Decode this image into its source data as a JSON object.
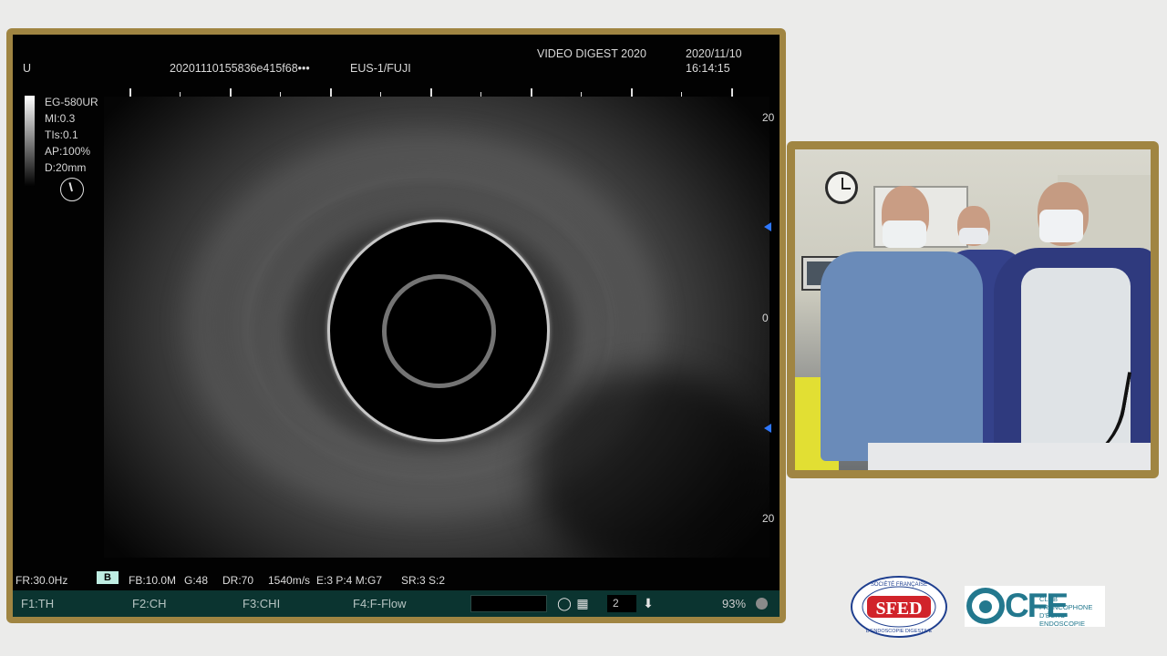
{
  "ultrasound": {
    "header": {
      "probe_orientation": "U",
      "study_id": "20201110155836e415f68•••",
      "scope": "EUS-1/FUJI",
      "event": "VIDEO DIGEST 2020",
      "date": "2020/11/10",
      "time": "16:14:15"
    },
    "params": [
      "EG-580UR",
      "MI:0.3",
      "TIs:0.1",
      "AP:100%",
      "D:20mm"
    ],
    "focus_mark": "F",
    "depth_scale": [
      "20",
      "0",
      "20"
    ],
    "status": {
      "frame_rate": "FR:30.0Hz",
      "mode": "B",
      "fb": "FB:10.0M",
      "gain": "G:48",
      "dynamic_range": "DR:70",
      "speed": "1540m/s",
      "enhance": "E:3 P:4 M:G7",
      "sr": "SR:3 S:2"
    },
    "function_keys": [
      {
        "key": "F1:",
        "label": "TH"
      },
      {
        "key": "F2:",
        "label": "CH"
      },
      {
        "key": "F3:",
        "label": "CHI"
      },
      {
        "key": "F4:",
        "label": "F-Flow"
      }
    ],
    "clip_count": "2",
    "storage": "93%",
    "icons": [
      "probe-icon",
      "roi-icon",
      "download-icon"
    ]
  },
  "logos": {
    "sfed": {
      "acronym": "SFED",
      "top_text": "SOCIÉTÉ FRANÇAISE",
      "bottom_text": "D'ENDOSCOPIE DIGESTIVE"
    },
    "cfe": {
      "letters": "CFE",
      "line1": "CLUB FRANCOPHONE",
      "line2": "D'ÉCHO-ENDOSCOPIE"
    }
  },
  "colors": {
    "frame_gold": "#a08542",
    "function_bar": "#0b3430",
    "focus_green": "#3fd13f",
    "marker_blue": "#2e78ff",
    "cfe_teal": "#23788e",
    "sfed_red": "#d1232a",
    "sfed_blue": "#1f3f8f"
  }
}
